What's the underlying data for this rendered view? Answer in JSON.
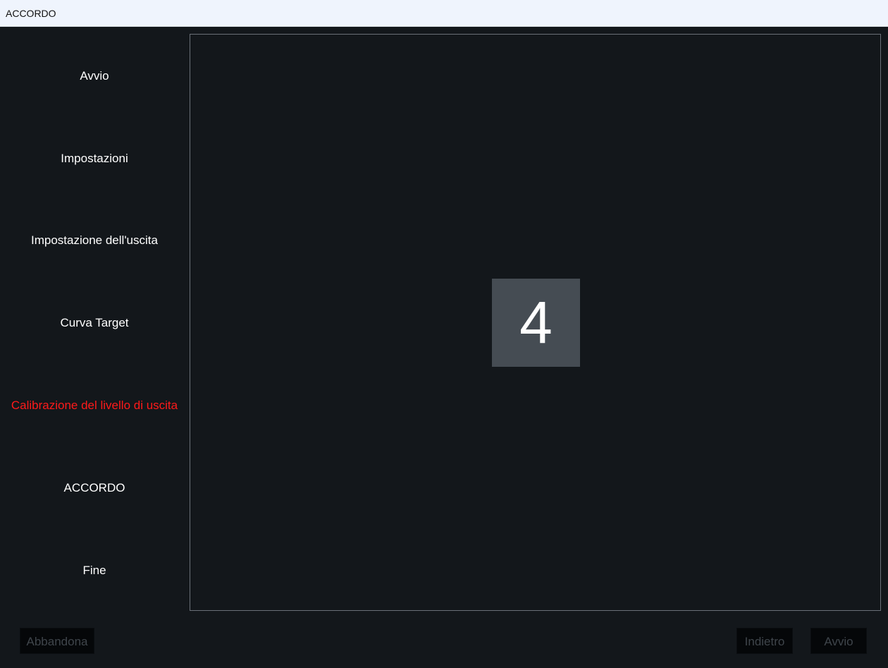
{
  "window": {
    "title": "ACCORDO"
  },
  "sidebar": {
    "steps": [
      {
        "label": "Avvio",
        "active": false
      },
      {
        "label": "Impostazioni",
        "active": false
      },
      {
        "label": "Impostazione dell'uscita",
        "active": false
      },
      {
        "label": "Curva Target",
        "active": false
      },
      {
        "label": "Calibrazione del livello di uscita",
        "active": true
      },
      {
        "label": "ACCORDO",
        "active": false
      },
      {
        "label": "Fine",
        "active": false
      }
    ]
  },
  "main": {
    "countdown_value": "4"
  },
  "footer": {
    "abandon_label": "Abbandona",
    "back_label": "Indietro",
    "start_label": "Avvio"
  },
  "colors": {
    "background": "#13171b",
    "active_step": "#ff1a1a",
    "countdown_box": "#454c53",
    "disabled_text": "#3f454b"
  }
}
